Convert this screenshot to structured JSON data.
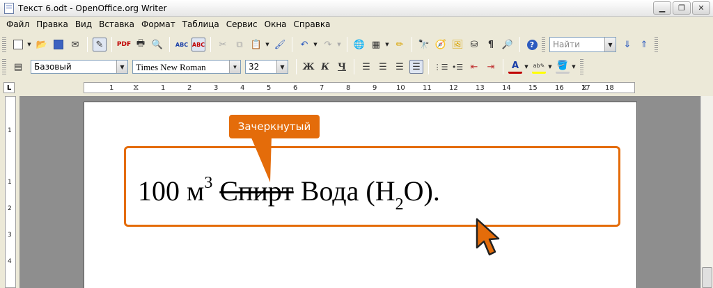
{
  "window": {
    "title": "Текст 6.odt - OpenOffice.org Writer"
  },
  "menu": {
    "items": [
      "Файл",
      "Правка",
      "Вид",
      "Вставка",
      "Формат",
      "Таблица",
      "Сервис",
      "Окна",
      "Справка"
    ]
  },
  "toolbar_standard": {
    "find_placeholder": "Найти",
    "icons": [
      "new-document-icon",
      "open-icon",
      "save-icon",
      "email-icon",
      "edit-mode-icon",
      "export-pdf-icon",
      "print-icon",
      "page-preview-icon",
      "spellcheck-icon",
      "autospellcheck-icon",
      "cut-icon",
      "copy-icon",
      "paste-icon",
      "format-paintbrush-icon",
      "undo-icon",
      "redo-icon",
      "hyperlink-icon",
      "table-icon",
      "draw-functions-icon",
      "navigator-icon",
      "gallery-icon",
      "data-sources-icon",
      "nonprinting-chars-icon",
      "zoom-icon",
      "help-icon",
      "find-next-icon",
      "find-previous-icon"
    ]
  },
  "toolbar_formatting": {
    "paragraph_style": "Базовый",
    "font_name": "Times New Roman",
    "font_size": "32",
    "bold_label": "Ж",
    "italic_label": "К",
    "underline_label": "Ч"
  },
  "ruler": {
    "horizontal_numbers": [
      "1",
      "1",
      "2",
      "3",
      "4",
      "5",
      "6",
      "7",
      "8",
      "9",
      "10",
      "11",
      "12",
      "13",
      "14",
      "15",
      "16",
      "17",
      "18"
    ],
    "vertical_numbers": [
      "1",
      "1",
      "2",
      "3"
    ]
  },
  "document": {
    "amount": "100 м",
    "superscript": "3",
    "struck_word": "Спирт",
    "after_strike": " Вода (H",
    "subscript": "2",
    "tail": "O)."
  },
  "annotation": {
    "callout_label": "Зачеркнутый",
    "accent_color": "#e46c0a"
  }
}
